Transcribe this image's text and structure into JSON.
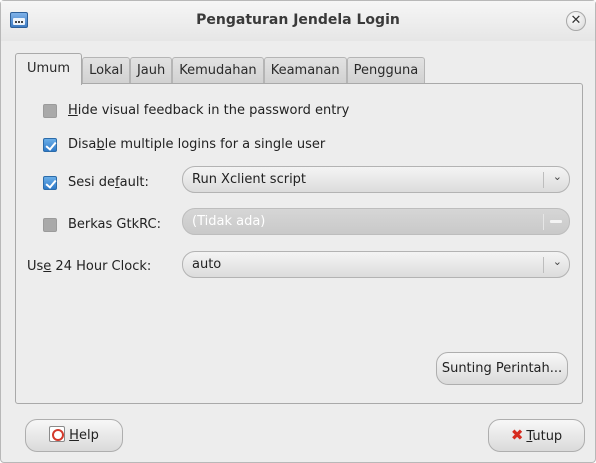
{
  "window": {
    "title": "Pengaturan Jendela Login"
  },
  "tabs": [
    {
      "label": "Umum",
      "active": true
    },
    {
      "label": "Lokal",
      "active": false
    },
    {
      "label": "Jauh",
      "active": false
    },
    {
      "label": "Kemudahan",
      "active": false
    },
    {
      "label": "Keamanan",
      "active": false
    },
    {
      "label": "Pengguna",
      "active": false
    }
  ],
  "options": {
    "hide_feedback": {
      "pre": "",
      "mn": "H",
      "post": "ide visual feedback in the password entry",
      "checked": false
    },
    "disable_multiple": {
      "pre": "Disa",
      "mn": "b",
      "post": "le multiple logins for a single user",
      "checked": true
    },
    "default_session": {
      "pre": "Sesi de",
      "mn": "f",
      "post": "ault:",
      "checked": true,
      "value": "Run Xclient script"
    },
    "gtkrc": {
      "label": "Berkas GtkRC:",
      "checked": false,
      "value": "(Tidak ada)"
    },
    "clock": {
      "pre": "Us",
      "mn": "e",
      "post": " 24 Hour Clock:",
      "value": "auto"
    }
  },
  "buttons": {
    "edit_commands": "Sunting Perintah...",
    "help": {
      "mn": "H",
      "post": "elp"
    },
    "close": {
      "mn": "T",
      "post": "utup"
    }
  },
  "colors": {
    "accent": "#3a84d0",
    "close_x": "#d62b1f"
  }
}
